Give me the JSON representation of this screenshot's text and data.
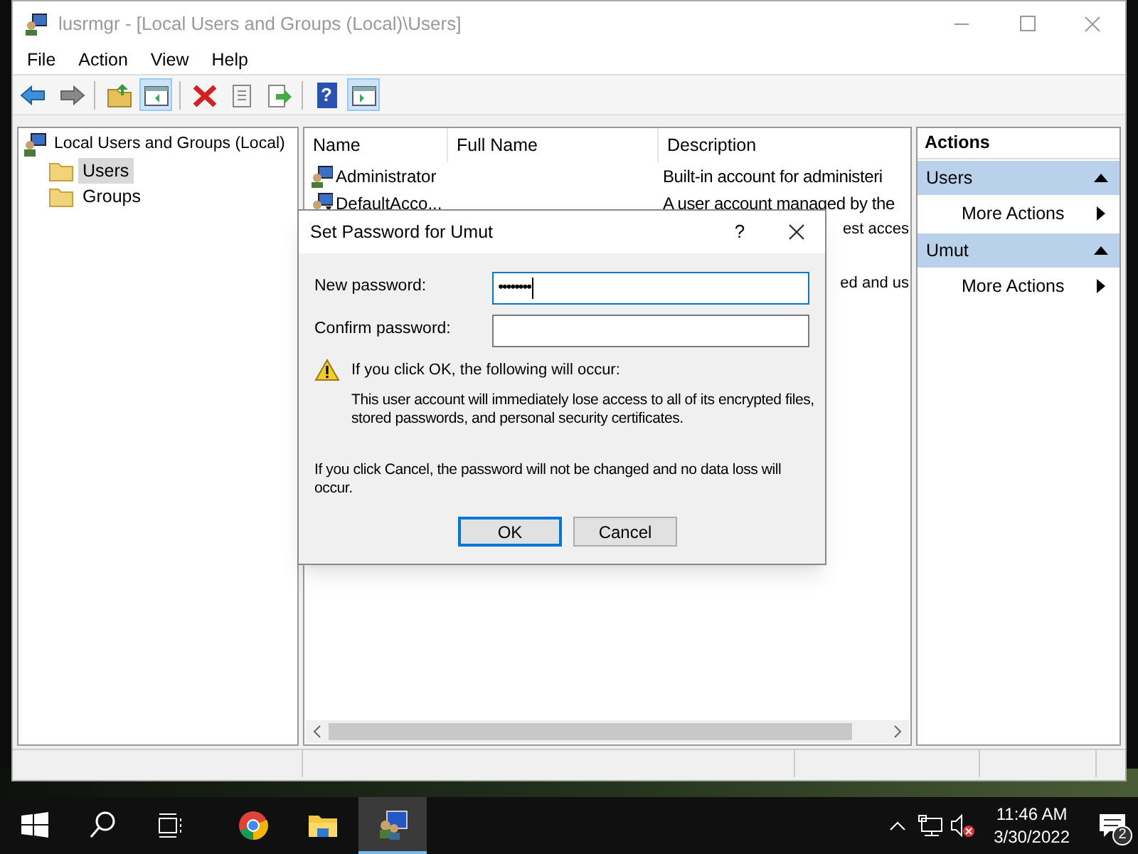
{
  "window": {
    "title": "lusrmgr - [Local Users and Groups (Local)\\Users]"
  },
  "menu": [
    "File",
    "Action",
    "View",
    "Help"
  ],
  "toolbar": [
    {
      "kind": "back",
      "pressed": false
    },
    {
      "kind": "forward",
      "pressed": false
    },
    {
      "kind": "sep"
    },
    {
      "kind": "up",
      "pressed": false
    },
    {
      "kind": "tree",
      "pressed": true
    },
    {
      "kind": "sep"
    },
    {
      "kind": "delete",
      "pressed": false
    },
    {
      "kind": "properties",
      "pressed": false
    },
    {
      "kind": "export",
      "pressed": false
    },
    {
      "kind": "sep"
    },
    {
      "kind": "help",
      "glyph": "?",
      "pressed": false
    },
    {
      "kind": "pane",
      "pressed": true
    }
  ],
  "tree": {
    "label": "Local Users and Groups (Local)",
    "children": [
      {
        "label": "Users",
        "selected": true
      },
      {
        "label": "Groups",
        "selected": false
      }
    ]
  },
  "list": {
    "columns": [
      "Name",
      "Full Name",
      "Description"
    ],
    "rows": [
      {
        "kind": "admin",
        "name": "Administrator",
        "description": "Built-in account for administeri",
        "selected": false
      },
      {
        "kind": "default",
        "name": "DefaultAcco...",
        "description": "A user account managed by the",
        "selected": false
      },
      {
        "kind": "covered",
        "description": "est acces",
        "selected": false
      },
      {
        "kind": "covered",
        "selected": false
      },
      {
        "kind": "covered",
        "description": "ed and us",
        "selected": false
      }
    ]
  },
  "actions": {
    "title": "Actions",
    "sections": [
      {
        "title": "Users",
        "expanded": true,
        "items": [
          "More Actions"
        ]
      },
      {
        "title": "Umut",
        "expanded": true,
        "items": [
          "More Actions"
        ]
      }
    ]
  },
  "dialog": {
    "title": "Set Password for Umut",
    "help": "?",
    "fields": [
      {
        "label": "New password:",
        "value": "••••••••",
        "focused": true
      },
      {
        "label": "Confirm password:",
        "focused": false
      }
    ],
    "warning_title": "If you click OK, the following will occur:",
    "warning_text": "This user account will immediately lose access to all of its encrypted files, stored passwords, and personal security certificates.",
    "note": "If you click Cancel, the password will not be changed and no data loss will occur.",
    "buttons": [
      {
        "label": "OK",
        "default": true
      },
      {
        "label": "Cancel",
        "default": false
      }
    ]
  },
  "taskbar": {
    "apps": [
      {
        "kind": "chrome",
        "active": false
      },
      {
        "kind": "explorer",
        "active": false
      },
      {
        "kind": "mmc",
        "active": true
      }
    ],
    "time": "11:46 AM",
    "date": "3/30/2022",
    "notifications": "2"
  }
}
